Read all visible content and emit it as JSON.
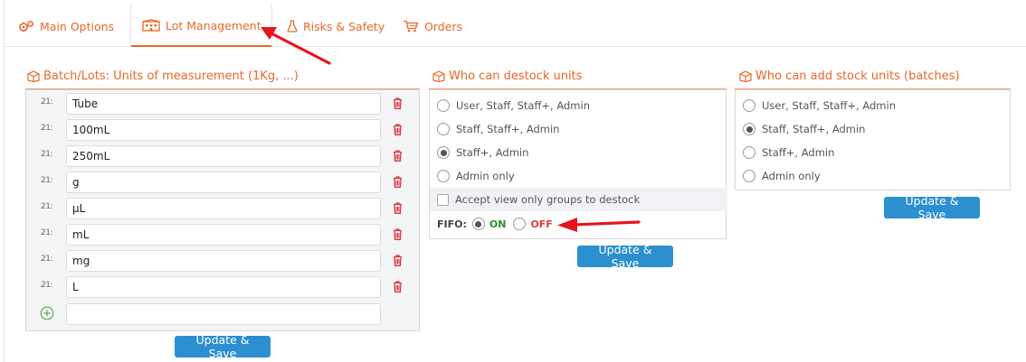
{
  "tabs": [
    {
      "label": "Main Options",
      "icon": "gears-icon"
    },
    {
      "label": "Lot Management",
      "icon": "building-icon"
    },
    {
      "label": "Risks & Safety",
      "icon": "flask-icon"
    },
    {
      "label": "Orders",
      "icon": "cart-icon"
    }
  ],
  "active_tab": "Lot Management",
  "units": {
    "title": "Batch/Lots: Units of measurement (1Kg, ...)",
    "handle": "21:",
    "items": [
      "Tube",
      "100mL",
      "250mL",
      "g",
      "µL",
      "mL",
      "mg",
      "L"
    ],
    "new_item_value": "",
    "save_label": "Update & Save"
  },
  "destock": {
    "title": "Who can destock units",
    "options": [
      "User, Staff, Staff+, Admin",
      "Staff, Staff+, Admin",
      "Staff+, Admin",
      "Admin only"
    ],
    "selected_index": 2,
    "checkbox_label": "Accept view only groups to destock",
    "checkbox_checked": false,
    "fifo_label": "FIFO:",
    "fifo_on": "ON",
    "fifo_off": "OFF",
    "fifo_value": "ON",
    "save_label": "Update & Save"
  },
  "add_stock": {
    "title": "Who can add stock units (batches)",
    "options": [
      "User, Staff, Staff+, Admin",
      "Staff, Staff+, Admin",
      "Staff+, Admin",
      "Admin only"
    ],
    "selected_index": 1,
    "save_label": "Update & Save"
  },
  "colors": {
    "accent": "#e8682a",
    "button": "#2c8fcf",
    "trash": "#d9363e",
    "on": "#2e8b2e",
    "off": "#e53935",
    "annotation_arrow": "#e8141b"
  }
}
